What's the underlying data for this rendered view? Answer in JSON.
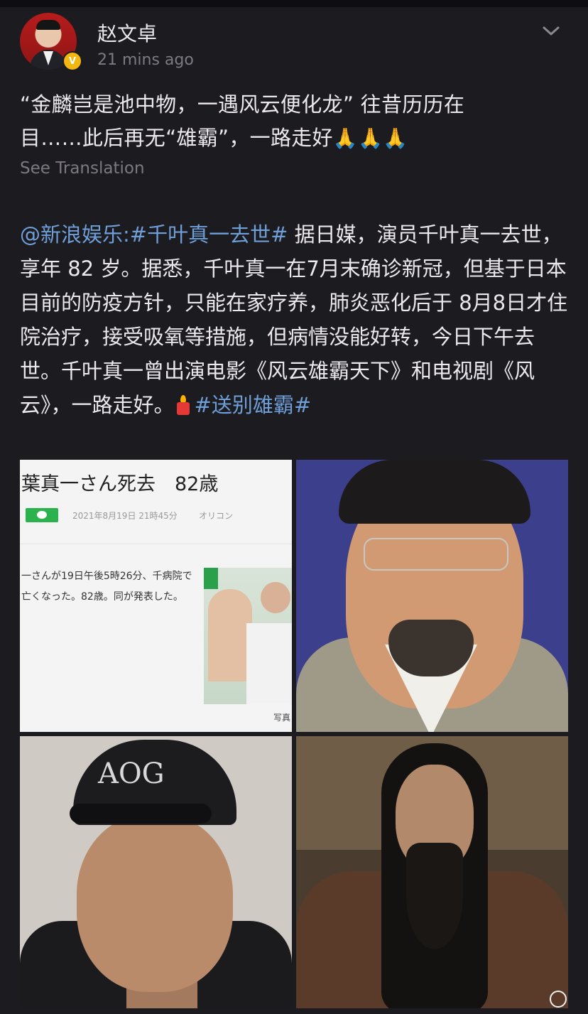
{
  "header": {
    "username": "赵文卓",
    "time": "21 mins ago",
    "verified_badge": "V"
  },
  "post": {
    "text_line1": "“金麟岂是池中物，一遇风云便化龙” 往昔历历在",
    "text_line2_prefix": "目……此后再无“雄霸”，一路走好",
    "text_emoji": "🙏🙏🙏",
    "see_translation": "See Translation"
  },
  "repost": {
    "mention": "@新浪娱乐",
    "colon": ":",
    "hashtag1": "#千叶真一去世#",
    "body": " 据日媒，演员千叶真一去世，享年 82 岁。据悉，千叶真一在7月末确诊新冠，但基于日本目前的防疫方针，只能在家疗养，肺炎恶化后于 8月8日才住院治疗，接受吸氧等措施，但病情没能好转，今日下午去世。千叶真一曾出演电影《风云雄霸天下》和电视剧《风云》，一路走好。",
    "hashtag2": "#送别雄霸#"
  },
  "images": {
    "news_title": "葉真一さん死去　82歳",
    "news_date": "2021年8月19日 21時45分",
    "news_source": "オリコン",
    "news_body": "一さんが19日午後5時26分、千病院で亡くなった。82歳。同が発表した。",
    "news_caption": "写真",
    "cap_text": "AOG"
  },
  "icons": {
    "chevron": "chevron-down-icon",
    "weibo": "weibo-watermark-icon"
  }
}
